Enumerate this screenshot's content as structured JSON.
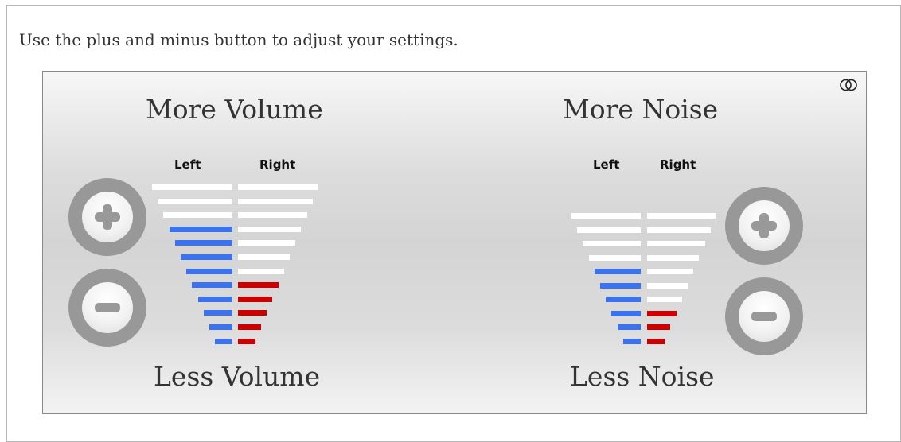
{
  "instructions": "Use the plus and minus button to adjust your settings.",
  "volume": {
    "top_label": "More Volume",
    "bottom_label": "Less Volume",
    "left_label": "Left",
    "right_label": "Right",
    "total_steps": 12,
    "left_level": 9,
    "right_level": 5
  },
  "noise": {
    "top_label": "More Noise",
    "bottom_label": "Less Noise",
    "left_label": "Left",
    "right_label": "Right",
    "total_steps": 10,
    "left_level": 6,
    "right_level": 3
  },
  "buttons": {
    "plus_icon": "plus-icon",
    "minus_icon": "minus-icon",
    "rings_icon": "interlocking-rings-icon"
  },
  "colors": {
    "left_active": "#3a72f0",
    "right_active": "#cc0000",
    "inactive": "#ffffff",
    "button_ring": "#989898"
  }
}
